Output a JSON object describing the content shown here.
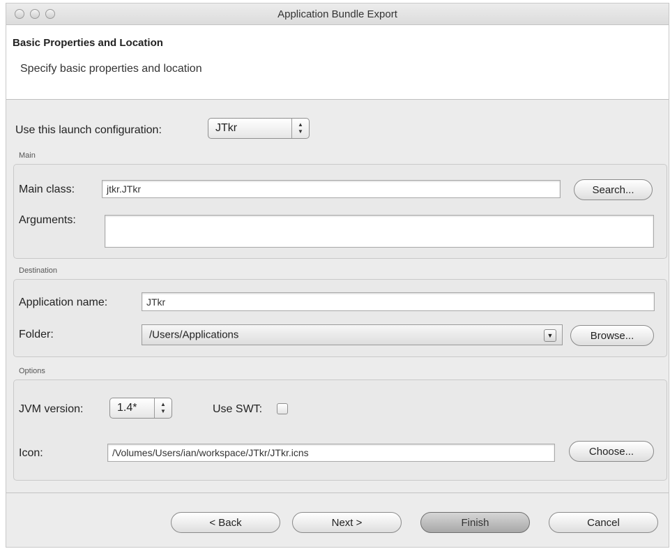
{
  "window": {
    "title": "Application Bundle Export"
  },
  "header": {
    "title": "Basic Properties and Location",
    "description": "Specify basic properties and location"
  },
  "launch": {
    "label": "Use this launch configuration:",
    "value": "JTkr"
  },
  "main": {
    "group_title": "Main",
    "main_class_label": "Main class:",
    "main_class_value": "jtkr.JTkr",
    "search_label": "Search...",
    "arguments_label": "Arguments:",
    "arguments_value": ""
  },
  "destination": {
    "group_title": "Destination",
    "app_name_label": "Application name:",
    "app_name_value": "JTkr",
    "folder_label": "Folder:",
    "folder_value": "/Users/Applications",
    "browse_label": "Browse..."
  },
  "options": {
    "group_title": "Options",
    "jvm_label": "JVM version:",
    "jvm_value": "1.4*",
    "swt_label": "Use SWT:",
    "swt_checked": false,
    "icon_label": "Icon:",
    "icon_value": "/Volumes/Users/ian/workspace/JTkr/JTkr.icns",
    "choose_label": "Choose..."
  },
  "footer": {
    "back_label": "< Back",
    "next_label": "Next >",
    "finish_label": "Finish",
    "cancel_label": "Cancel"
  }
}
